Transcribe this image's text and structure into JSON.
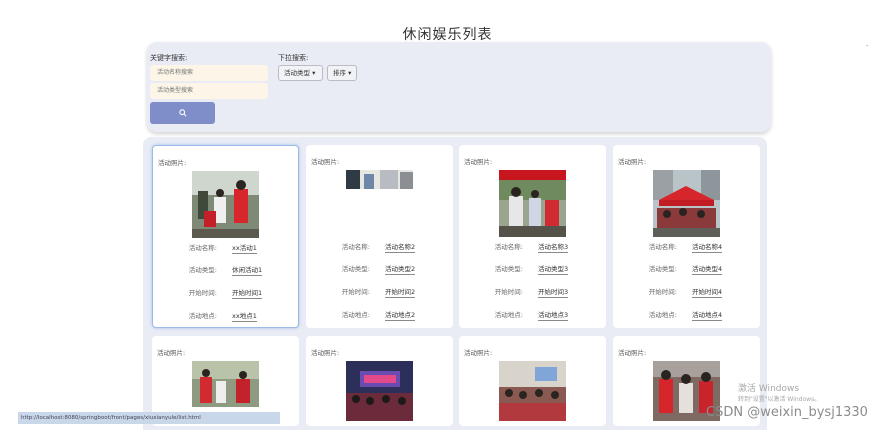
{
  "page": {
    "title": "休闲娱乐列表"
  },
  "search": {
    "keyword_label": "关键字搜索:",
    "name_placeholder": "活动名称搜索",
    "type_placeholder": "活动类型搜索",
    "search_icon": "search-icon",
    "dropdown_label": "下拉搜索:",
    "type_dropdown": "活动类型",
    "sort_dropdown": "排序"
  },
  "field_labels": {
    "photo": "活动照片:",
    "name": "活动名称:",
    "type": "活动类型:",
    "time": "开始时间:",
    "place": "活动地点:"
  },
  "cards": [
    {
      "name": "xx活动1",
      "type": "休闲活动1",
      "time": "开始时间1",
      "place": "xx地点1"
    },
    {
      "name": "活动名称2",
      "type": "活动类型2",
      "time": "开始时间2",
      "place": "活动地点2"
    },
    {
      "name": "活动名称3",
      "type": "活动类型3",
      "time": "开始时间3",
      "place": "活动地点3"
    },
    {
      "name": "活动名称4",
      "type": "活动类型4",
      "time": "开始时间4",
      "place": "活动地点4"
    }
  ],
  "overlays": {
    "windows_line1": "激活 Windows",
    "windows_line2": "转到\"设置\"以激活 Windows。",
    "csdn": "CSDN @weixin_bysj1330",
    "taskbar": "http://localhost:8080/springboot/front/pages/xiuxianyule/list.html",
    "dot": "·"
  },
  "colors": {
    "accent": "#7f8dc8",
    "panel": "#e9ecf5",
    "input": "#fdf6e8"
  }
}
